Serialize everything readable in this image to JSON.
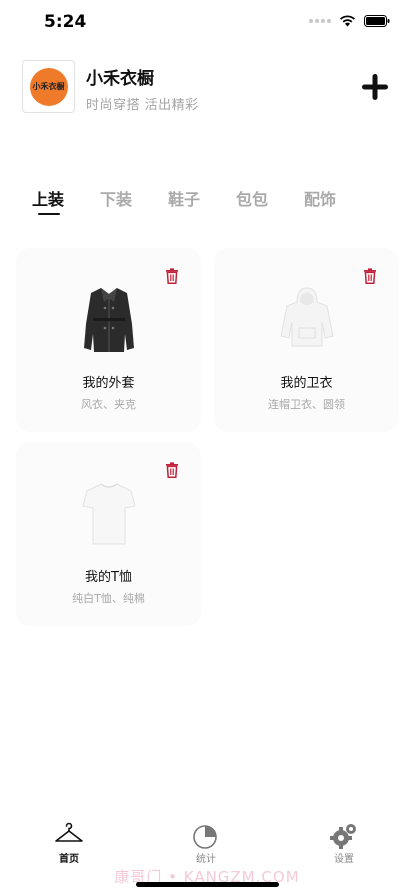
{
  "status_bar": {
    "time": "5:24"
  },
  "header": {
    "logo_text": "小禾衣橱",
    "title": "小禾衣橱",
    "subtitle": "时尚穿搭 活出精彩"
  },
  "tabs": [
    {
      "label": "上装",
      "active": true
    },
    {
      "label": "下装",
      "active": false
    },
    {
      "label": "鞋子",
      "active": false
    },
    {
      "label": "包包",
      "active": false
    },
    {
      "label": "配饰",
      "active": false
    }
  ],
  "items": [
    {
      "title": "我的外套",
      "desc": "风衣、夹克",
      "icon": "coat-icon"
    },
    {
      "title": "我的卫衣",
      "desc": "连帽卫衣、圆领",
      "icon": "hoodie-icon"
    },
    {
      "title": "我的T恤",
      "desc": "纯白T恤、纯棉",
      "icon": "tshirt-icon"
    }
  ],
  "bottom_nav": [
    {
      "label": "首页",
      "icon": "hanger-icon",
      "active": true
    },
    {
      "label": "统计",
      "icon": "pie-chart-icon",
      "active": false
    },
    {
      "label": "设置",
      "icon": "gears-icon",
      "active": false
    }
  ],
  "watermark": "康哥门 • KANGZM.COM",
  "colors": {
    "accent": "#111111",
    "delete": "#c0223a",
    "muted": "#a8a8a8",
    "logo": "#ee7a2a"
  }
}
